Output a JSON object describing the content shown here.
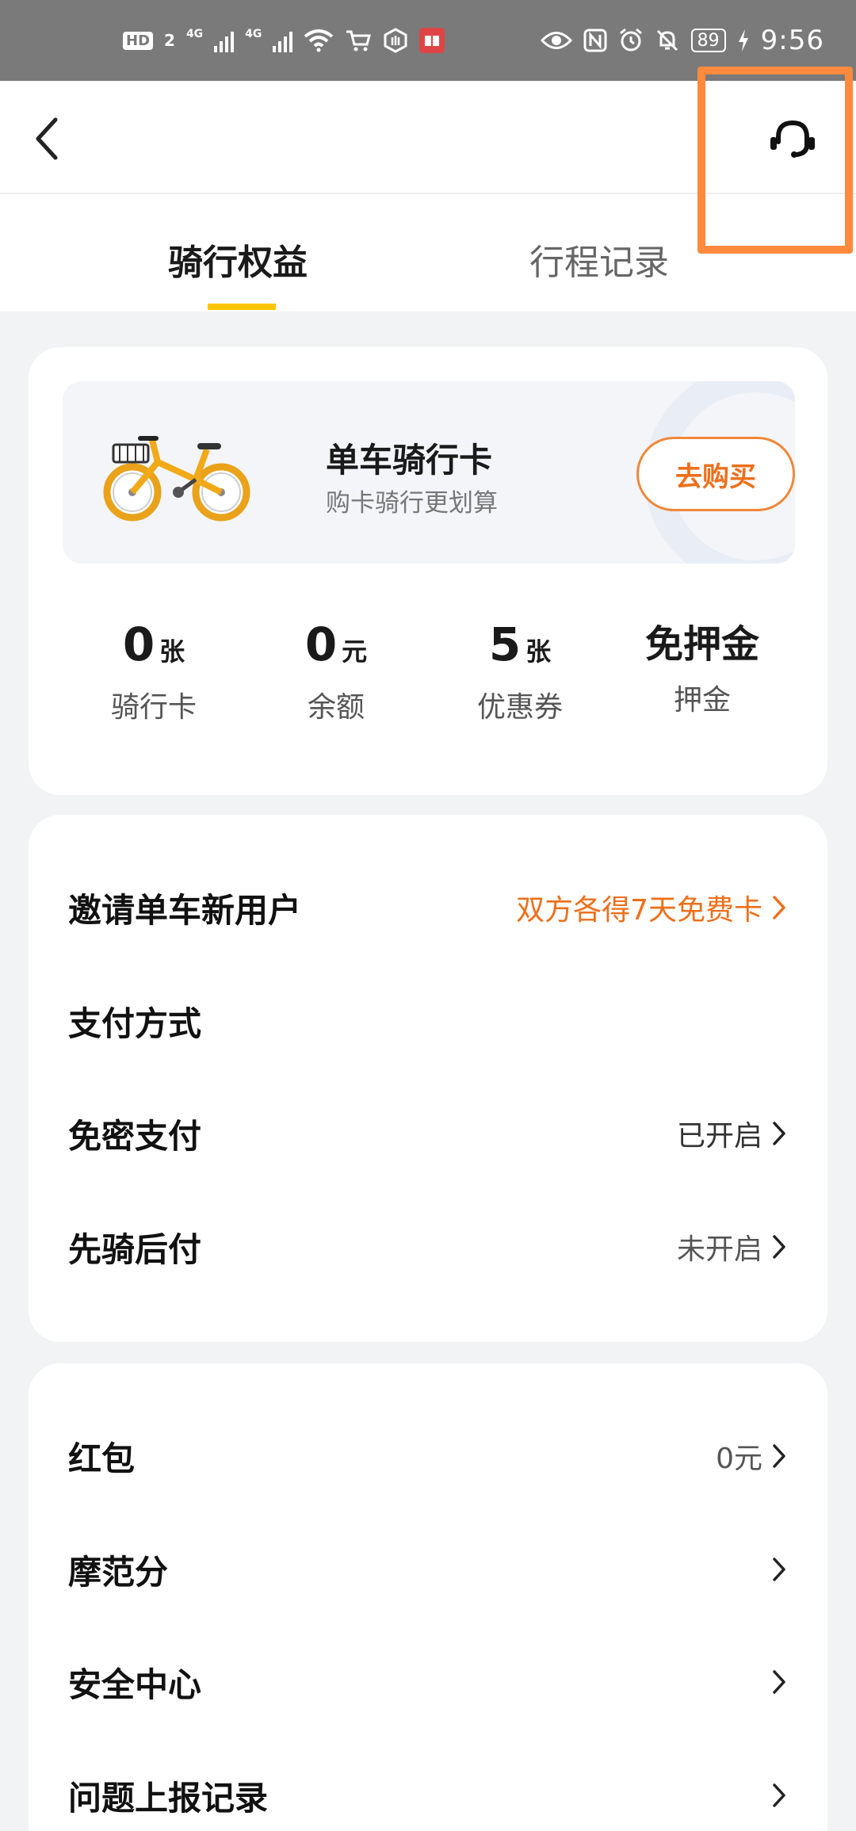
{
  "status_bar": {
    "hd": "HD",
    "sim2": "2",
    "net1": "4G",
    "net2": "4G",
    "battery": "89",
    "time": "9:56"
  },
  "icons": {
    "back": "chevron-left-icon",
    "service": "headset-icon",
    "chevron": "chevron-right-icon",
    "bike": "bike-icon"
  },
  "colors": {
    "accent_orange": "#ee6f1a",
    "tab_underline": "#ffc400",
    "highlight_box": "#ff8a3d",
    "background": "#f2f3f5"
  },
  "tabs": [
    {
      "label": "骑行权益",
      "active": true
    },
    {
      "label": "行程记录",
      "active": false
    }
  ],
  "promo": {
    "title": "单车骑行卡",
    "subtitle": "购卡骑行更划算",
    "button": "去购买"
  },
  "stats": [
    {
      "value": "0",
      "unit": "张",
      "label": "骑行卡"
    },
    {
      "value": "0",
      "unit": "元",
      "label": "余额"
    },
    {
      "value": "5",
      "unit": "张",
      "label": "优惠券"
    },
    {
      "value": "免押金",
      "unit": "",
      "label": "押金"
    }
  ],
  "section1": [
    {
      "label": "邀请单车新用户",
      "value": "双方各得7天免费卡",
      "chevron": true
    },
    {
      "label": "支付方式",
      "value": "",
      "chevron": false
    },
    {
      "label": "免密支付",
      "value": "已开启",
      "chevron": true
    },
    {
      "label": "先骑后付",
      "value": "未开启",
      "chevron": true
    }
  ],
  "section2": [
    {
      "label": "红包",
      "value": "0元",
      "chevron": true
    },
    {
      "label": "摩范分",
      "value": "",
      "chevron": true
    },
    {
      "label": "安全中心",
      "value": "",
      "chevron": true
    },
    {
      "label": "问题上报记录",
      "value": "",
      "chevron": true
    }
  ]
}
